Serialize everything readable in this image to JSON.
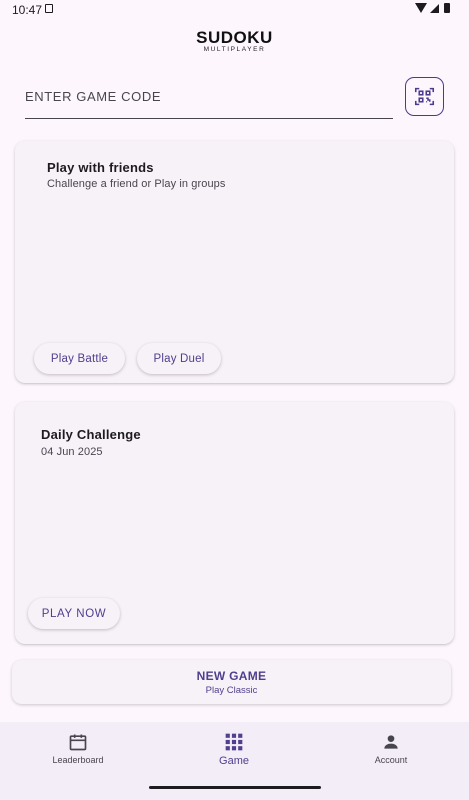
{
  "status_bar": {
    "time": "10:47"
  },
  "logo": {
    "main": "SUDOKU",
    "sub": "MULTIPLAYER"
  },
  "game_code": {
    "placeholder": "ENTER GAME CODE",
    "value": ""
  },
  "qr_button": {
    "icon": "qr-scan-icon"
  },
  "play_with_friends": {
    "title": "Play with friends",
    "subtitle": "Challenge a friend or Play in groups",
    "battle_label": "Play Battle",
    "duel_label": "Play Duel"
  },
  "daily_challenge": {
    "title": "Daily Challenge",
    "date": "04 Jun 2025",
    "play_label": "PLAY NOW"
  },
  "new_game": {
    "title": "NEW GAME",
    "subtitle": "Play Classic"
  },
  "nav": {
    "items": [
      {
        "label": "Leaderboard",
        "icon": "calendar-icon"
      },
      {
        "label": "Game",
        "icon": "grid-icon",
        "active": true
      },
      {
        "label": "Account",
        "icon": "person-icon"
      }
    ]
  },
  "colors": {
    "accent": "#4f3f8e",
    "background": "#fdf7fd",
    "card": "#f7f1f8",
    "nav": "#f3edf7"
  }
}
